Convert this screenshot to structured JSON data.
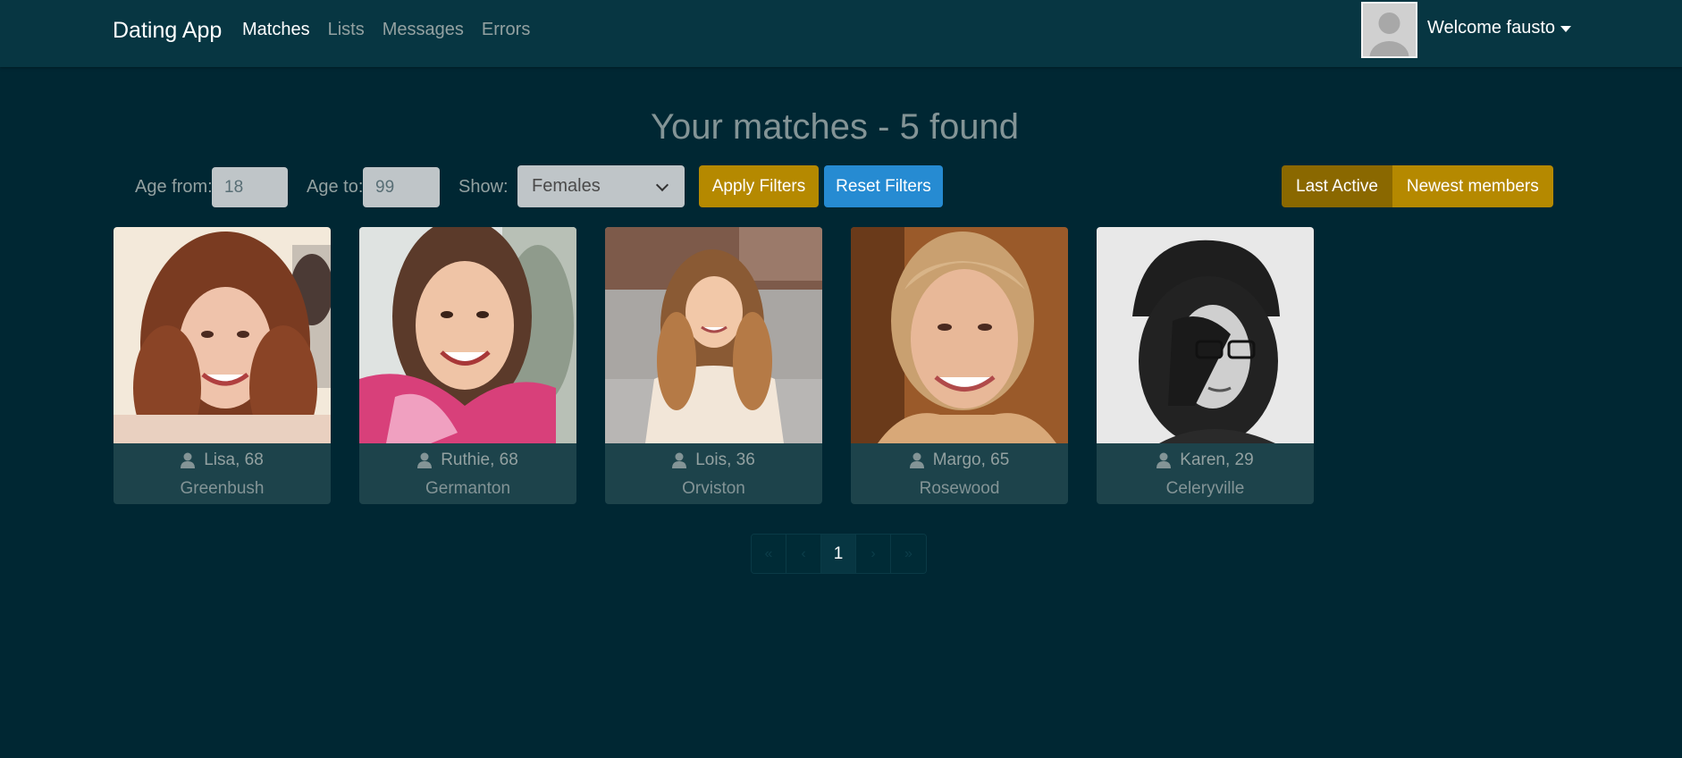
{
  "colors": {
    "background": "#002733",
    "navbar": "#073642",
    "accent_gold": "#b58900",
    "accent_blue": "#268bd2",
    "card_footer": "#1d434b"
  },
  "navbar": {
    "brand": "Dating App",
    "links": [
      {
        "label": "Matches",
        "active": true
      },
      {
        "label": "Lists",
        "active": false
      },
      {
        "label": "Messages",
        "active": false
      },
      {
        "label": "Errors",
        "active": false
      }
    ],
    "welcome": "Welcome fausto",
    "avatar_icon": "user-silhouette-icon"
  },
  "page": {
    "title": "Your matches - 5 found"
  },
  "filters": {
    "age_from_label": "Age from:",
    "age_from_value": "18",
    "age_to_label": "Age to:",
    "age_to_value": "99",
    "show_label": "Show:",
    "show_value": "Females",
    "apply_label": "Apply Filters",
    "reset_label": "Reset Filters",
    "sort": {
      "last_active_label": "Last Active",
      "newest_label": "Newest members",
      "selected": "Last Active"
    }
  },
  "members": [
    {
      "name_age": "Lisa, 68",
      "city": "Greenbush"
    },
    {
      "name_age": "Ruthie, 68",
      "city": "Germanton"
    },
    {
      "name_age": "Lois, 36",
      "city": "Orviston"
    },
    {
      "name_age": "Margo, 65",
      "city": "Rosewood"
    },
    {
      "name_age": "Karen, 29",
      "city": "Celeryville"
    }
  ],
  "pagination": {
    "first": "«",
    "prev": "‹",
    "current": "1",
    "next": "›",
    "last": "»"
  }
}
